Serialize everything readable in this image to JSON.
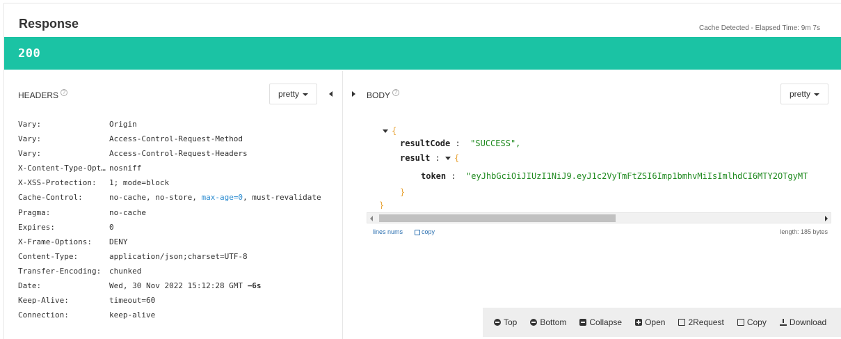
{
  "response": {
    "title": "Response",
    "meta": "Cache Detected - Elapsed Time: 9m 7s",
    "status_code": "200",
    "colors": {
      "status_bar": "#1bc3a4",
      "json_string": "#1f8a1f",
      "json_brace": "#e8a53a",
      "link": "#2a8bd0"
    }
  },
  "headers_pane": {
    "title": "HEADERS",
    "format": "pretty",
    "rows": [
      {
        "key": "Vary:",
        "value": "Origin"
      },
      {
        "key": "Vary:",
        "value": "Access-Control-Request-Method"
      },
      {
        "key": "Vary:",
        "value": "Access-Control-Request-Headers"
      },
      {
        "key": "X-Content-Type-Opt…",
        "value": "nosniff"
      },
      {
        "key": "X-XSS-Protection:",
        "value": "1; mode=block"
      },
      {
        "key": "Cache-Control:",
        "value_a": "no-cache, no-store, ",
        "value_link": "max-age=0",
        "value_b": ", must-revalidate"
      },
      {
        "key": "Pragma:",
        "value": "no-cache"
      },
      {
        "key": "Expires:",
        "value": "0"
      },
      {
        "key": "X-Frame-Options:",
        "value": "DENY"
      },
      {
        "key": "Content-Type:",
        "value": "application/json;charset=UTF-8"
      },
      {
        "key": "Transfer-Encoding:",
        "value": "chunked"
      },
      {
        "key": "Date:",
        "value": "Wed, 30 Nov 2022 15:12:28 GMT ",
        "value_bold": "−6s"
      },
      {
        "key": "Keep-Alive:",
        "value": "timeout=60"
      },
      {
        "key": "Connection:",
        "value": "keep-alive"
      }
    ]
  },
  "body_pane": {
    "title": "BODY",
    "format": "pretty",
    "json": {
      "open_brace": "{",
      "close_brace": "}",
      "result_code_key": "resultCode",
      "result_code_value": "\"SUCCESS\",",
      "result_key": "result",
      "result_open": "{",
      "result_close": "}",
      "token_key": "token",
      "token_value": "\"eyJhbGciOiJIUzI1NiJ9.eyJ1c2VyTmFtZSI6Imp1bmhvMiIsImlhdCI6MTY2OTgyMT"
    },
    "lines_nums": "lines nums",
    "copy": "copy",
    "length": "length: 185 bytes"
  },
  "toolbar": {
    "top": "Top",
    "bottom": "Bottom",
    "collapse": "Collapse",
    "open": "Open",
    "to_request": "2Request",
    "copy": "Copy",
    "download": "Download"
  }
}
